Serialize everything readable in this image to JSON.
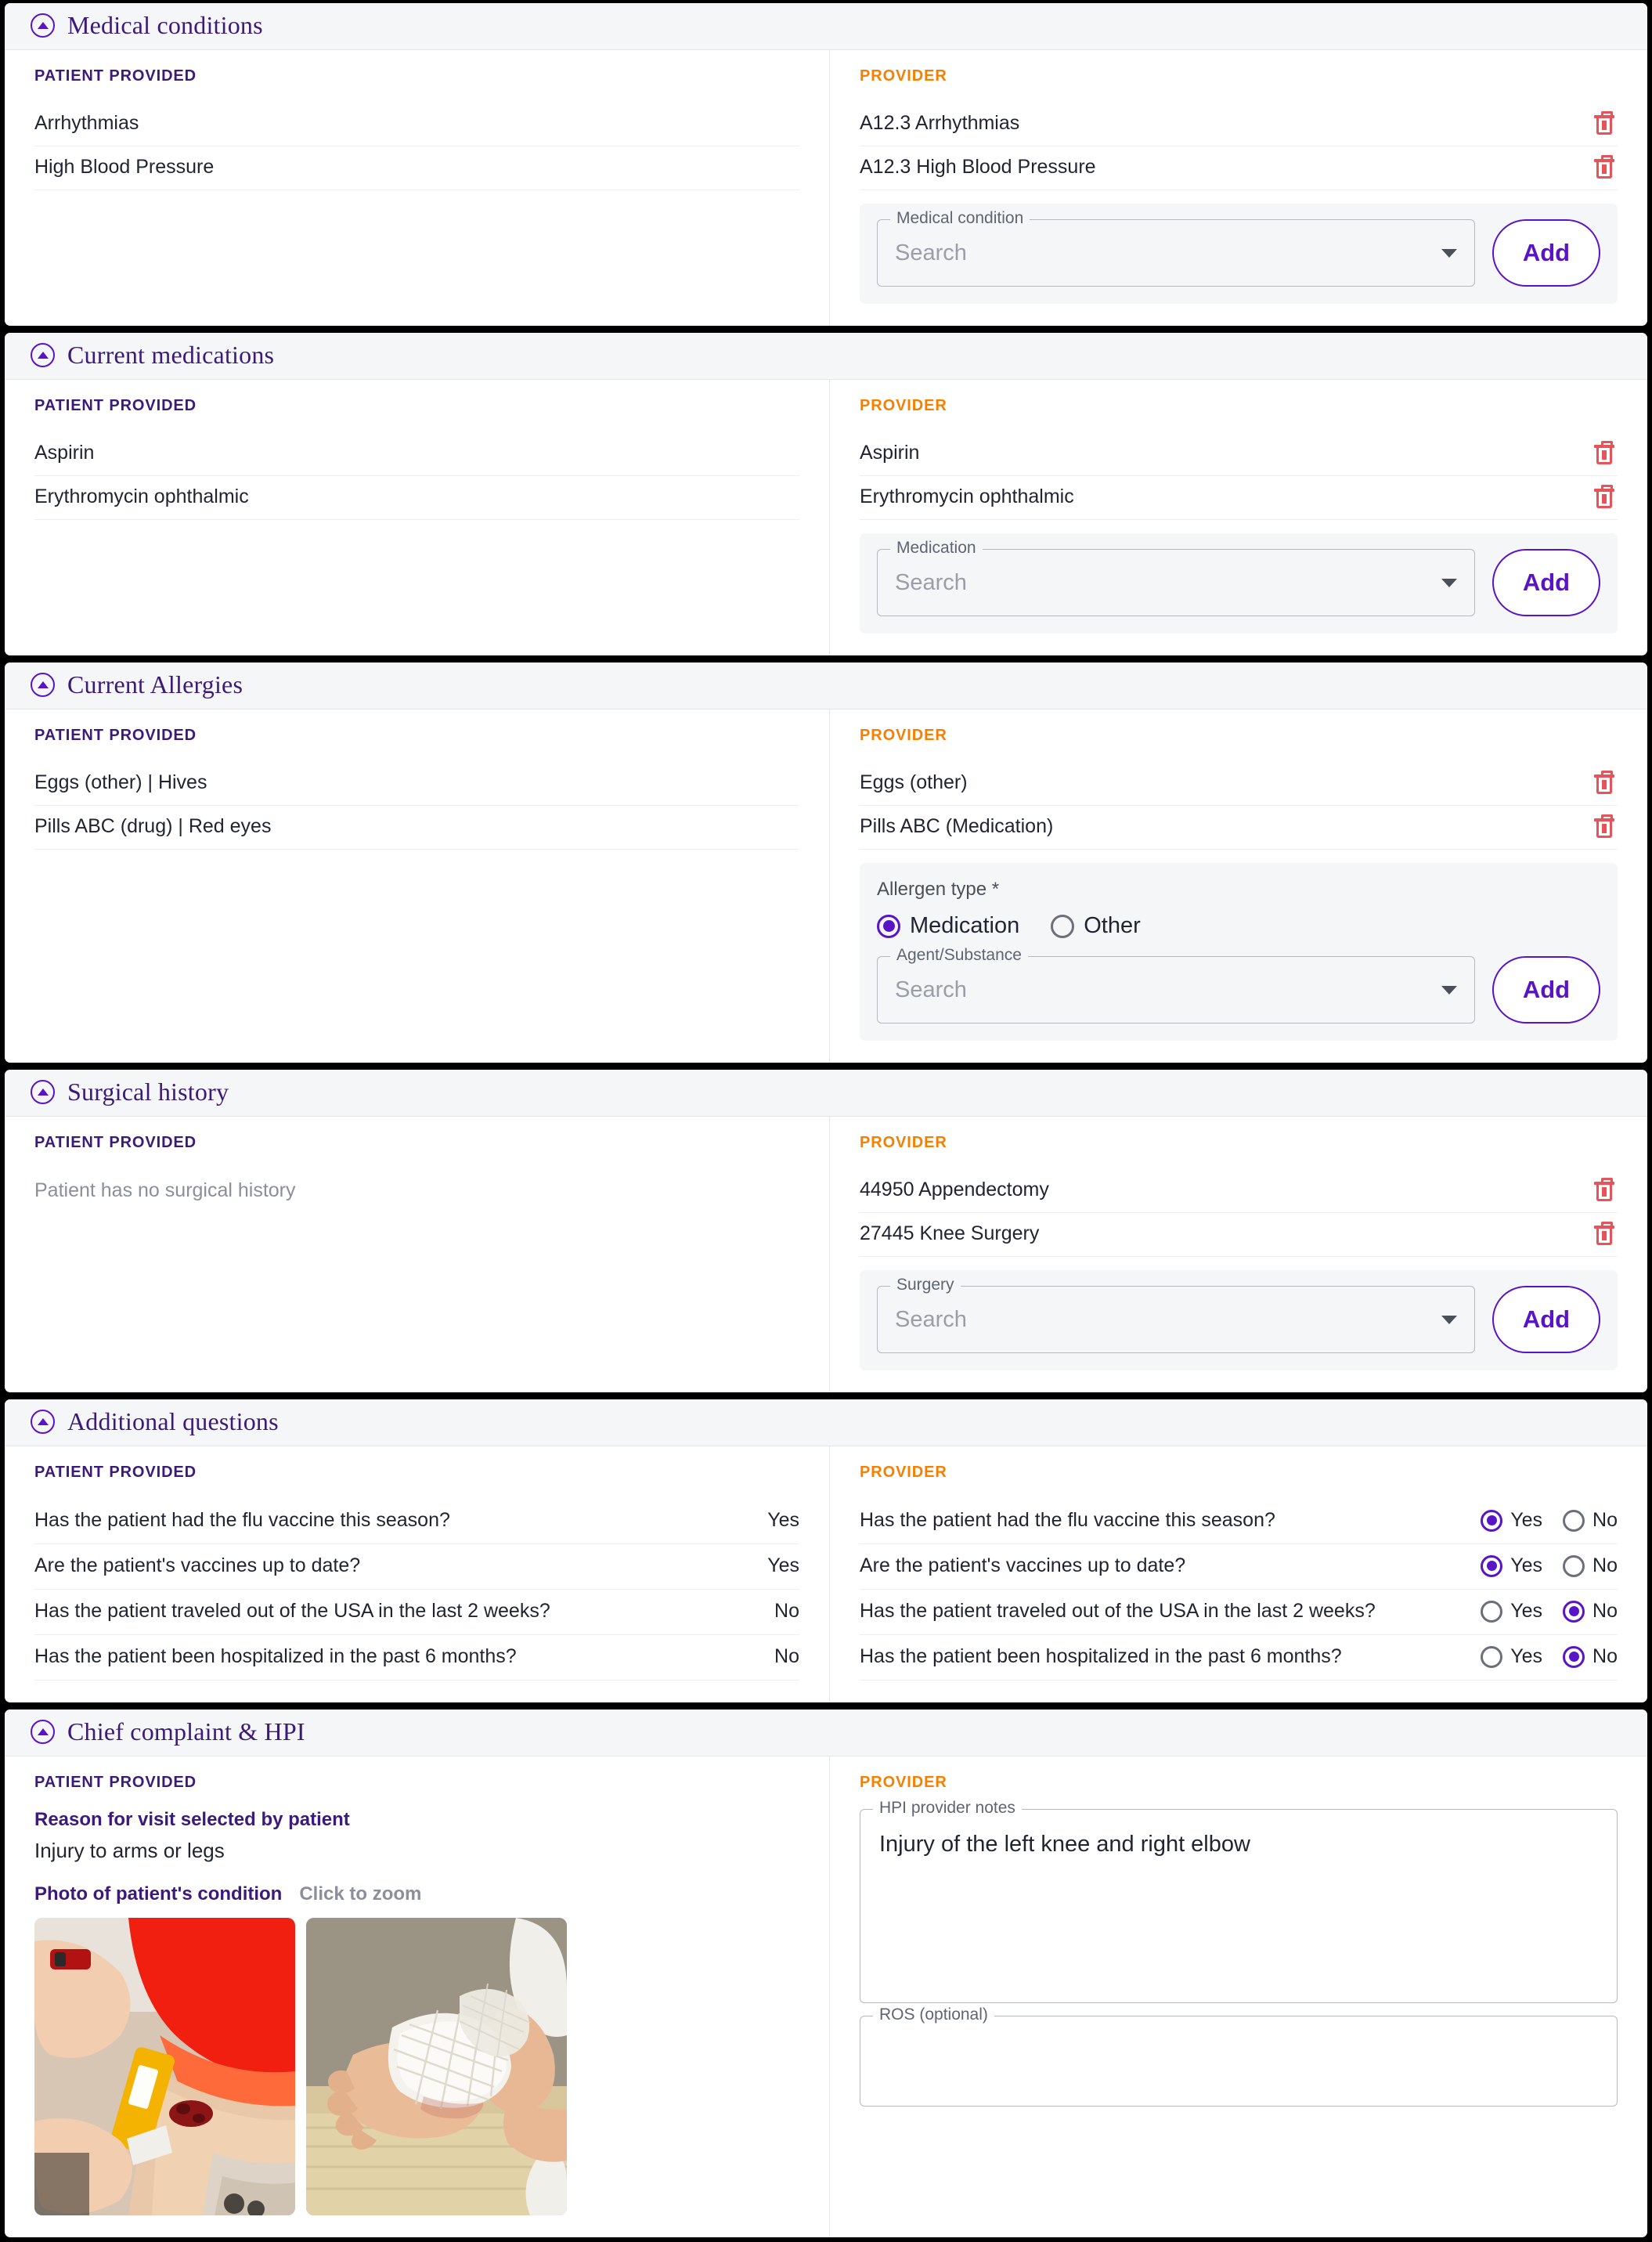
{
  "common": {
    "patient_label": "PATIENT PROVIDED",
    "provider_label": "PROVIDER",
    "add_label": "Add",
    "search_placeholder": "Search",
    "yes_label": "Yes",
    "no_label": "No",
    "trash_icon": "trash-icon",
    "caret_icon": "chevron-down-icon",
    "collapse_icon": "collapse-up-icon"
  },
  "colors": {
    "accent_purple": "#5a14c8",
    "title_purple": "#3b1a78",
    "provider_orange": "#f77f00",
    "delete_red": "#e8535a",
    "header_bg": "#f5f6f8"
  },
  "sections": {
    "medical_conditions": {
      "title": "Medical conditions",
      "patient_items": [
        "Arrhythmias",
        "High Blood Pressure"
      ],
      "provider_items": [
        "A12.3 Arrhythmias",
        "A12.3 High Blood Pressure"
      ],
      "field_legend": "Medical condition"
    },
    "current_medications": {
      "title": "Current medications",
      "patient_items": [
        "Aspirin",
        "Erythromycin ophthalmic"
      ],
      "provider_items": [
        "Aspirin",
        "Erythromycin ophthalmic"
      ],
      "field_legend": "Medication"
    },
    "current_allergies": {
      "title": "Current Allergies",
      "patient_items": [
        "Eggs (other) | Hives",
        "Pills ABC (drug) | Red eyes"
      ],
      "provider_items": [
        "Eggs (other)",
        "Pills ABC (Medication)"
      ],
      "allergen_type_label": "Allergen type *",
      "allergen_options": [
        "Medication",
        "Other"
      ],
      "allergen_selected": "Medication",
      "field_legend": "Agent/Substance"
    },
    "surgical_history": {
      "title": "Surgical history",
      "patient_empty_text": "Patient has no surgical history",
      "provider_items": [
        "44950 Appendectomy",
        "27445 Knee Surgery"
      ],
      "field_legend": "Surgery"
    },
    "additional_questions": {
      "title": "Additional questions",
      "questions": [
        {
          "text": "Has the patient had the flu vaccine this season?",
          "patient_answer": "Yes",
          "provider_answer": "Yes"
        },
        {
          "text": "Are the patient's vaccines up to date?",
          "patient_answer": "Yes",
          "provider_answer": "Yes"
        },
        {
          "text": "Has the patient traveled out of the USA in the last 2 weeks?",
          "patient_answer": "No",
          "provider_answer": "No"
        },
        {
          "text": "Has the patient been hospitalized in the past 6 months?",
          "patient_answer": "No",
          "provider_answer": "No"
        }
      ]
    },
    "chief_complaint": {
      "title": "Chief complaint & HPI",
      "reason_heading": "Reason for visit selected by patient",
      "reason_value": "Injury to arms or legs",
      "photo_heading": "Photo of patient's condition",
      "photo_hint": "Click to zoom",
      "photo_alt_1": "child-knee-bandage-photo",
      "photo_alt_2": "child-hand-gauze-photo",
      "hpi_legend": "HPI provider notes",
      "hpi_value": "Injury of the left knee and right elbow",
      "ros_legend": "ROS (optional)",
      "ros_value": ""
    }
  }
}
